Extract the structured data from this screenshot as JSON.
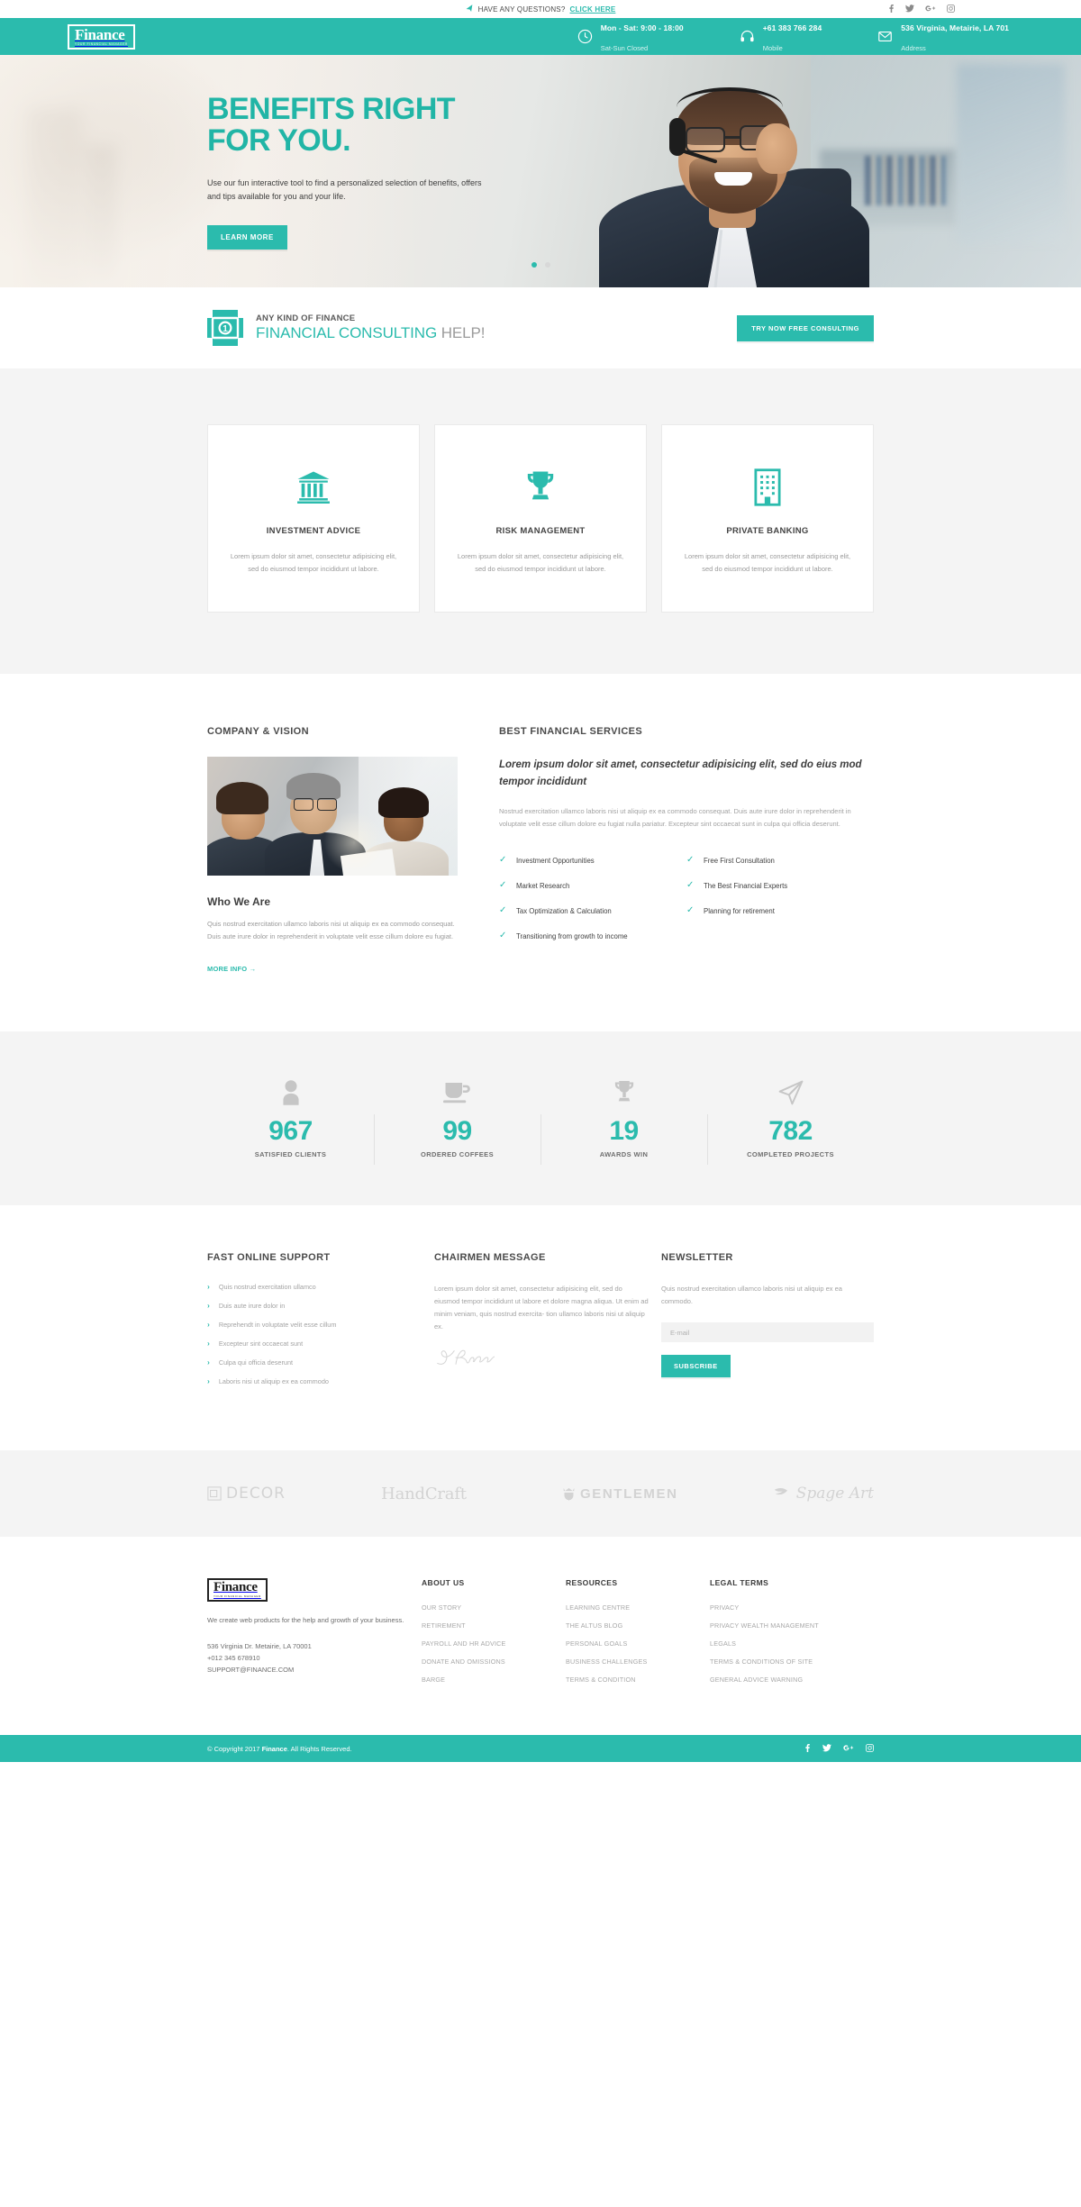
{
  "topbar": {
    "plane_icon": "paper-plane-icon",
    "question_text": "HAVE ANY QUESTIONS?",
    "question_link": "CLICK HERE",
    "social": [
      {
        "name": "facebook-icon",
        "glyph": "f"
      },
      {
        "name": "twitter-icon",
        "glyph": "🐦"
      },
      {
        "name": "google-plus-icon",
        "glyph": "G+"
      },
      {
        "name": "instagram-icon",
        "glyph": "□"
      }
    ]
  },
  "header": {
    "logo_word": "Finance",
    "logo_sub": "YOUR FINANCIAL MANAGER",
    "info": [
      {
        "icon": "clock-icon",
        "line1": "Mon - Sat: 9:00 - 18:00",
        "line2": "Sat-Sun Closed"
      },
      {
        "icon": "headset-icon",
        "line1": "+61 383 766 284",
        "line2": "Mobile"
      },
      {
        "icon": "envelope-icon",
        "line1": "536 Virginia, Metairie, LA 701",
        "line2": "Address"
      }
    ]
  },
  "hero": {
    "title_line1": "BENEFITS RIGHT",
    "title_line2": "FOR YOU.",
    "subtitle": "Use our fun interactive tool to find a personalized selection of benefits, offers and tips available for you and your life.",
    "cta_label": "LEARN MORE",
    "slides": 2,
    "active_slide": 1,
    "accent_color": "#21b5a6"
  },
  "consult": {
    "icon": "money-note-icon",
    "eyebrow": "ANY KIND OF FINANCE",
    "title_teal": "FINANCIAL CONSULTING",
    "title_grey": "HELP!",
    "cta_label": "TRY NOW FREE CONSULTING"
  },
  "services": {
    "cards": [
      {
        "icon": "bank-icon",
        "title": "INVESTMENT ADVICE",
        "text": "Lorem ipsum dolor sit amet, consectetur adipisicing elit, sed do eiusmod tempor incididunt ut labore."
      },
      {
        "icon": "trophy-icon",
        "title": "RISK MANAGEMENT",
        "text": "Lorem ipsum dolor sit amet, consectetur adipisicing elit, sed do eiusmod tempor incididunt ut labore."
      },
      {
        "icon": "building-icon",
        "title": "PRIVATE BANKING",
        "text": "Lorem ipsum dolor sit amet, consectetur adipisicing elit, sed do eiusmod tempor incididunt ut labore."
      }
    ]
  },
  "about": {
    "left_title": "COMPANY & VISION",
    "photo_alt": "team-meeting-photo",
    "who_heading": "Who We Are",
    "who_text": "Quis nostrud exercitation ullamco laboris nisi ut aliquip ex ea commodo consequat. Duis aute irure dolor in reprehenderit in voluptate velit esse cillum dolore eu fugiat.",
    "more_info": "MORE INFO →",
    "right_title": "BEST FINANCIAL SERVICES",
    "lead": "Lorem ipsum dolor sit amet, consectetur adipisicing elit, sed do eius mod tempor incididunt",
    "body": "Nostrud exercitation ullamco laboris nisi ut aliquip ex ea commodo consequat. Duis aute irure dolor in reprehenderit in voluptate velit esse cillum dolore eu fugiat nulla pariatur. Excepteur sint occaecat sunt in culpa qui officia deserunt.",
    "features_left": [
      "Investment Opportunities",
      "Market Research",
      "Tax Optimization & Calculation",
      "Transitioning from growth to income"
    ],
    "features_right": [
      "Free First Consultation",
      "The Best Financial Experts",
      "Planning for retirement"
    ]
  },
  "counters": [
    {
      "icon": "user-icon",
      "value": "967",
      "label": "SATISFIED CLIENTS"
    },
    {
      "icon": "coffee-cup-icon",
      "value": "99",
      "label": "ORDERED COFFEES"
    },
    {
      "icon": "trophy-icon",
      "value": "19",
      "label": "AWARDS WIN"
    },
    {
      "icon": "paper-plane-icon",
      "value": "782",
      "label": "COMPLETED PROJECTS"
    }
  ],
  "support": {
    "title": "FAST ONLINE SUPPORT",
    "items": [
      "Quis nostrud exercitation ullamco",
      "Duis aute irure dolor in",
      "Reprehendt in voluptate velit esse cillum",
      "Excepteur sint occaecat sunt",
      "Culpa qui officia deserunt",
      "Laboris nisi ut aliquip ex ea commodo"
    ]
  },
  "chairmen": {
    "title": "CHAIRMEN MESSAGE",
    "text": "Lorem ipsum dolor sit amet, consectetur adipisicing elit, sed do eiusmod tempor incididunt ut labore et dolore magna aliqua. Ut enim ad minim veniam, quis nostrud exercita- tion ullamco laboris nisi ut aliquip ex.",
    "signature_alt": "chairman-signature"
  },
  "newsletter": {
    "title": "NEWSLETTER",
    "text": "Quis nostrud exercitation ullamco laboris nisi ut aliquip ex ea commodo.",
    "input_placeholder": "E-mail",
    "input_value": "",
    "button_label": "SUBSCRIBE"
  },
  "partners": [
    {
      "name": "decor-logo",
      "text": "DECOR"
    },
    {
      "name": "handcraft-logo",
      "text": "HandCraft"
    },
    {
      "name": "gentlemen-logo",
      "text": "GENTLEMEN"
    },
    {
      "name": "spage-art-logo",
      "text": "Spage Art"
    }
  ],
  "footer": {
    "logo_word": "Finance",
    "logo_sub": "YOUR FINANCIAL MANAGER",
    "tagline": "We create web products for the help and growth of your business.",
    "address": "536 Virginia Dr. Metairie, LA 70001",
    "phone": "+012 345 678910",
    "email": "SUPPORT@FINANCE.COM",
    "columns": [
      {
        "heading": "ABOUT US",
        "links": [
          "OUR STORY",
          "RETIREMENT",
          "PAYROLL AND HR ADVICE",
          "DONATE AND OMISSIONS",
          "BARGE"
        ]
      },
      {
        "heading": "RESOURCES",
        "links": [
          "LEARNING CENTRE",
          "THE ALTUS BLOG",
          "PERSONAL GOALS",
          "BUSINESS CHALLENGES",
          "TERMS & CONDITION"
        ]
      },
      {
        "heading": "LEGAL TERMS",
        "links": [
          "PRIVACY",
          "PRIVACY WEALTH MANAGEMENT",
          "LEGALS",
          "TERMS & CONDITIONS OF SITE",
          "GENERAL ADVICE WARNING"
        ]
      }
    ]
  },
  "copyright": {
    "prefix": "© Copyright 2017 ",
    "brand": "Finance",
    "suffix": ". All Rights Reserved.",
    "social": [
      {
        "name": "facebook-icon",
        "glyph": "f"
      },
      {
        "name": "twitter-icon",
        "glyph": "🐦"
      },
      {
        "name": "google-plus-icon",
        "glyph": "G+"
      },
      {
        "name": "instagram-icon",
        "glyph": "□"
      }
    ]
  },
  "theme": {
    "teal": "#2bbbad",
    "light_grey": "#f4f4f4",
    "text_grey": "#a3a3a3"
  }
}
